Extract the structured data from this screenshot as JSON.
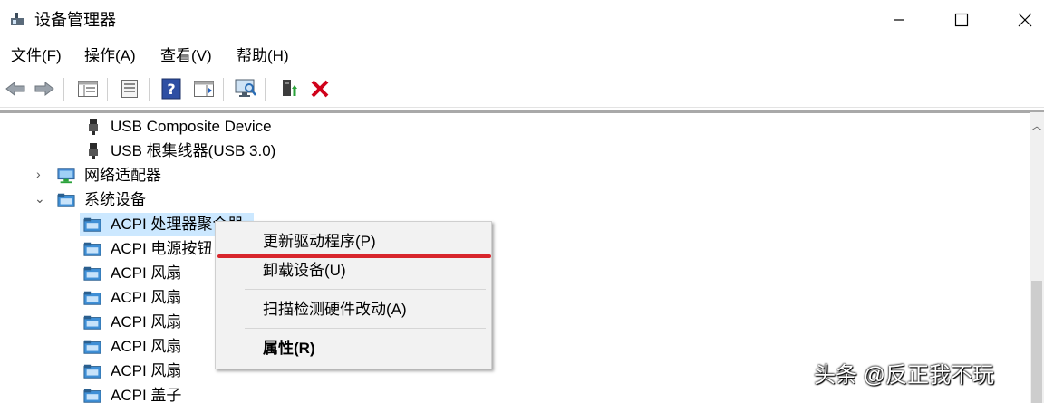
{
  "window": {
    "title": "设备管理器"
  },
  "menubar": {
    "items": [
      "文件(F)",
      "操作(A)",
      "查看(V)",
      "帮助(H)"
    ]
  },
  "tree": {
    "rows": [
      {
        "label": "USB Composite Device"
      },
      {
        "label": "USB 根集线器(USB 3.0)"
      },
      {
        "label": "网络适配器"
      },
      {
        "label": "系统设备"
      },
      {
        "label": "ACPI 处理器聚合器"
      },
      {
        "label": "ACPI 电源按钮"
      },
      {
        "label": "ACPI 风扇"
      },
      {
        "label": "ACPI 风扇"
      },
      {
        "label": "ACPI 风扇"
      },
      {
        "label": "ACPI 风扇"
      },
      {
        "label": "ACPI 风扇"
      },
      {
        "label": "ACPI 盖子"
      }
    ]
  },
  "context_menu": {
    "update_driver": "更新驱动程序(P)",
    "uninstall": "卸载设备(U)",
    "scan": "扫描检测硬件改动(A)",
    "properties": "属性(R)"
  },
  "watermark": "头条 @反正我不玩",
  "colors": {
    "selection": "#cce8ff",
    "highlight_line": "#d8262c",
    "delete_icon": "#d0021b"
  }
}
